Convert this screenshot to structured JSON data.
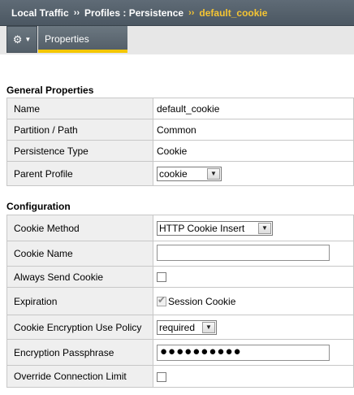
{
  "breadcrumb": {
    "items": [
      "Local Traffic",
      "Profiles : Persistence"
    ],
    "separator": "››",
    "current": "default_cookie"
  },
  "tabs": {
    "options_icon": "gear-icon",
    "active_tab": "Properties"
  },
  "general": {
    "title": "General Properties",
    "rows": [
      {
        "label": "Name",
        "value": "default_cookie"
      },
      {
        "label": "Partition / Path",
        "value": "Common"
      },
      {
        "label": "Persistence Type",
        "value": "Cookie"
      },
      {
        "label": "Parent Profile",
        "value": "cookie"
      }
    ]
  },
  "configuration": {
    "title": "Configuration",
    "cookie_method": {
      "label": "Cookie Method",
      "value": "HTTP Cookie Insert"
    },
    "cookie_name": {
      "label": "Cookie Name",
      "value": ""
    },
    "always_send": {
      "label": "Always Send Cookie",
      "checked": false
    },
    "expiration": {
      "label": "Expiration",
      "checkbox_label": "Session Cookie",
      "checked": true
    },
    "encryption_policy": {
      "label": "Cookie Encryption Use Policy",
      "value": "required"
    },
    "passphrase": {
      "label": "Encryption Passphrase",
      "masked": "●●●●●●●●●●"
    },
    "override_limit": {
      "label": "Override Connection Limit",
      "checked": false
    }
  },
  "colors": {
    "header_bg": "#5a6570",
    "current_crumb": "#f5c533",
    "tab_underline": "#f4c700",
    "label_bg": "#efefef"
  }
}
